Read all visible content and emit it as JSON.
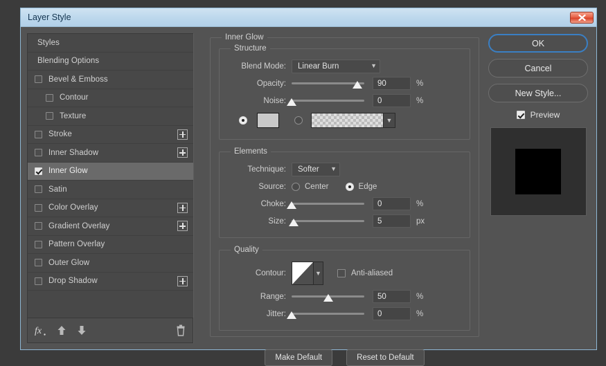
{
  "window": {
    "title": "Layer Style",
    "close_icon": "close-x-icon"
  },
  "sidebar": {
    "items": [
      {
        "label": "Styles",
        "type": "plain",
        "checked": null,
        "expand": false
      },
      {
        "label": "Blending Options",
        "type": "plain",
        "checked": null,
        "expand": false
      },
      {
        "label": "Bevel & Emboss",
        "type": "check",
        "checked": false,
        "expand": false
      },
      {
        "label": "Contour",
        "type": "indent",
        "checked": false,
        "expand": false
      },
      {
        "label": "Texture",
        "type": "indent",
        "checked": false,
        "expand": false
      },
      {
        "label": "Stroke",
        "type": "check",
        "checked": false,
        "expand": true
      },
      {
        "label": "Inner Shadow",
        "type": "check",
        "checked": false,
        "expand": true
      },
      {
        "label": "Inner Glow",
        "type": "check",
        "checked": true,
        "expand": false,
        "selected": true
      },
      {
        "label": "Satin",
        "type": "check",
        "checked": false,
        "expand": false
      },
      {
        "label": "Color Overlay",
        "type": "check",
        "checked": false,
        "expand": true
      },
      {
        "label": "Gradient Overlay",
        "type": "check",
        "checked": false,
        "expand": true
      },
      {
        "label": "Pattern Overlay",
        "type": "check",
        "checked": false,
        "expand": false
      },
      {
        "label": "Outer Glow",
        "type": "check",
        "checked": false,
        "expand": false
      },
      {
        "label": "Drop Shadow",
        "type": "check",
        "checked": false,
        "expand": true
      }
    ],
    "toolbar": {
      "fx_icon": "fx-icon",
      "move_up_icon": "arrow-up-icon",
      "move_down_icon": "arrow-down-icon",
      "delete_icon": "trash-icon"
    }
  },
  "main": {
    "group_title": "Inner Glow",
    "structure": {
      "title": "Structure",
      "blend_mode_label": "Blend Mode:",
      "blend_mode_value": "Linear Burn",
      "opacity_label": "Opacity:",
      "opacity_value": "90",
      "opacity_unit": "%",
      "opacity_percent": 90,
      "noise_label": "Noise:",
      "noise_value": "0",
      "noise_unit": "%",
      "noise_percent": 0,
      "fill_mode": "color",
      "color_swatch_hex": "#c9c9c9",
      "gradient_name": "transparent-gradient"
    },
    "elements": {
      "title": "Elements",
      "technique_label": "Technique:",
      "technique_value": "Softer",
      "source_label": "Source:",
      "source_center_label": "Center",
      "source_edge_label": "Edge",
      "source_value": "Edge",
      "choke_label": "Choke:",
      "choke_value": "0",
      "choke_unit": "%",
      "choke_percent": 0,
      "size_label": "Size:",
      "size_value": "5",
      "size_unit": "px",
      "size_percent": 3
    },
    "quality": {
      "title": "Quality",
      "contour_label": "Contour:",
      "contour_preset": "linear-contour",
      "anti_aliased_label": "Anti-aliased",
      "anti_aliased_checked": false,
      "range_label": "Range:",
      "range_value": "50",
      "range_unit": "%",
      "range_percent": 50,
      "jitter_label": "Jitter:",
      "jitter_value": "0",
      "jitter_unit": "%",
      "jitter_percent": 0
    },
    "make_default_label": "Make Default",
    "reset_default_label": "Reset to Default"
  },
  "actions": {
    "ok_label": "OK",
    "cancel_label": "Cancel",
    "new_style_label": "New Style...",
    "preview_label": "Preview",
    "preview_checked": true,
    "focus_color": "#3a7fc4"
  }
}
